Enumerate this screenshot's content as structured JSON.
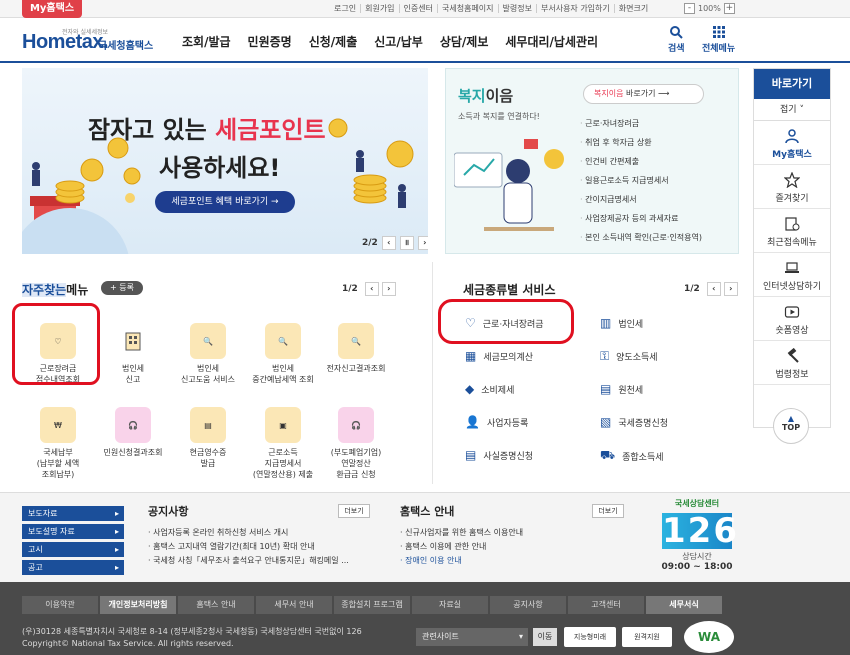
{
  "topbar": {
    "myhome_tab": "My홈택스",
    "links": [
      "로그인",
      "회원가입",
      "인증센터",
      "국세청홈페이지",
      "발령정보",
      "부서사용자 가입하기",
      "화면크기"
    ],
    "zoom_minus": "-",
    "zoom_value": "100%",
    "zoom_plus": "+"
  },
  "header": {
    "logo_tag": "전자와 실세세정보",
    "logo_main": "Hometax.",
    "logo_sub": "국세청홈택스",
    "menu": [
      "조회/발급",
      "민원증명",
      "신청/제출",
      "신고/납부",
      "상담/제보",
      "세무대리/납세관리"
    ],
    "search_label": "검색",
    "allmenu_label": "전체메뉴"
  },
  "banner": {
    "title_part1": "잠자고 있는 ",
    "title_highlight": "세금포인트",
    "title_line2": "사용하세요!",
    "button": "세금포인트 혜택 바로가기  →",
    "pager": "2/2"
  },
  "welfare": {
    "title_colored": "복지",
    "title_rest": "이음",
    "desc": "소득과 복지를 연결하다!",
    "button_highlight": "복지이음",
    "button_rest": " 바로가기  ⟶",
    "items": [
      "근로·자녀장려금",
      "취업 후 학자금 상환",
      "인건비 간편제출",
      "일용근로소득 지급명세서",
      "간이지급명세서",
      "사업장제공자 등의 과세자료",
      "본인 소득내역 확인(근로·인적용역)"
    ]
  },
  "sidebar": {
    "head": "바로가기",
    "fold": "접기 ˅",
    "items": [
      "My홈택스",
      "즐겨찾기",
      "최근접속메뉴",
      "인터넷상담하기",
      "숏폼영상",
      "법령정보"
    ],
    "top": "TOP"
  },
  "frequent": {
    "title_highlight": "자주찾는",
    "title_rest": "메뉴",
    "register": "+ 등록",
    "pager": "1/2",
    "tiles": [
      {
        "label": "근로장려금\n접수내역조회"
      },
      {
        "label": "법인세\n신고"
      },
      {
        "label": "법인세\n신고도움 서비스"
      },
      {
        "label": "법인세\n중간예납세액 조회"
      },
      {
        "label": "전자신고결과조회"
      },
      {
        "label": "국세납부\n(납부할 세액\n조회납부)"
      },
      {
        "label": "민원신청결과조회"
      },
      {
        "label": "현금영수증\n발급"
      },
      {
        "label": "근로소득\n지급명세서\n(연말정산용) 제출"
      },
      {
        "label": "(부도폐업기업)\n연말정산\n환급금 신청"
      }
    ]
  },
  "tax_services": {
    "title": "세금종류별 서비스",
    "pager": "1/2",
    "items": [
      "근로·자녀장려금",
      "법인세",
      "세금모의계산",
      "양도소득세",
      "소비제세",
      "원천세",
      "사업자등록",
      "국세증명신청",
      "사실증명신청",
      "종합소득세"
    ]
  },
  "notice_nav": [
    "보도자료",
    "보도설명 자료",
    "고시",
    "공고"
  ],
  "notices": {
    "title": "공지사항",
    "more": "더보기",
    "items": [
      "사업자등록 온라인 취하신청 서비스 개시",
      "홈택스 고지내역 열람기간(최대 10년) 확대 안내",
      "국세청 사칭「세무조사 출석요구 안내통지문」해킹메일 ..."
    ]
  },
  "hometax_info": {
    "title": "홈택스 안내",
    "more": "더보기",
    "items": [
      "신규사업자를 위한 홈택스 이용안내",
      "홈택스 이용에 관한 안내",
      "장애인 이용 안내"
    ]
  },
  "call_center": {
    "label": "국세상담센터",
    "number": "126",
    "hours_label": "상담시간",
    "hours": "09:00 ~ 18:00"
  },
  "footer_nav": [
    "이용약관",
    "개인정보처리방침",
    "홈택스 안내",
    "세무서 안내",
    "종합설치 프로그램",
    "자료실",
    "공지사항",
    "고객센터",
    "세무서식"
  ],
  "footer": {
    "address": "(우)30128 세종특별자치시 국세청로 8-14 (정부세종2청사 국세청동) 국세청상담센터 국번없이 126",
    "copyright": "Copyright© National Tax Service. All rights reserved.",
    "related_sites": "관련사이트",
    "go": "이동",
    "badge1": "지능형미래",
    "badge2": "원격지원",
    "wa": "WA"
  },
  "colors": {
    "brand": "#1b4f9a",
    "accent": "#e8344e",
    "teal": "#28a8a8"
  }
}
